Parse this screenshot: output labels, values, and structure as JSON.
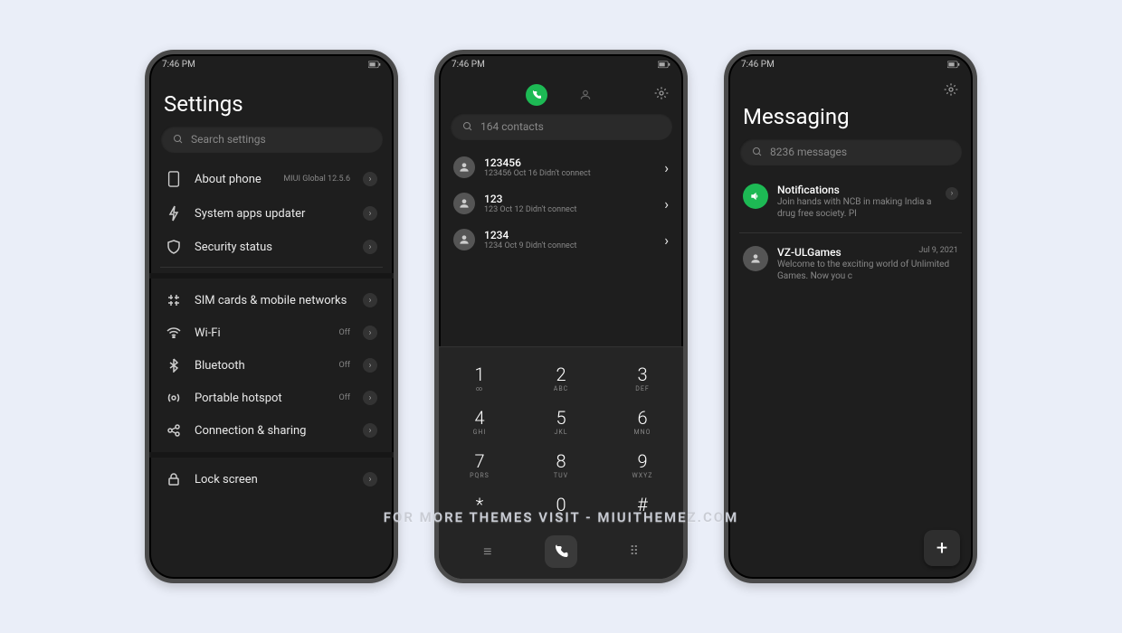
{
  "status": {
    "time": "7:46 PM"
  },
  "settings": {
    "title": "Settings",
    "search_placeholder": "Search settings",
    "items": [
      {
        "label": "About phone",
        "sub": "MIUI Global 12.5.6"
      },
      {
        "label": "System apps updater"
      },
      {
        "label": "Security status"
      }
    ],
    "net_items": [
      {
        "label": "SIM cards & mobile networks"
      },
      {
        "label": "Wi-Fi",
        "status": "Off"
      },
      {
        "label": "Bluetooth",
        "status": "Off"
      },
      {
        "label": "Portable hotspot",
        "status": "Off"
      },
      {
        "label": "Connection & sharing"
      }
    ],
    "lock": {
      "label": "Lock screen"
    }
  },
  "phone": {
    "search_placeholder": "164 contacts",
    "calls": [
      {
        "name": "123456",
        "detail": "123456  Oct 16 Didn't connect"
      },
      {
        "name": "123",
        "detail": "123  Oct 12 Didn't connect"
      },
      {
        "name": "1234",
        "detail": "1234  Oct 9 Didn't connect"
      }
    ],
    "dialpad": [
      {
        "num": "1",
        "let": "∞"
      },
      {
        "num": "2",
        "let": "ABC"
      },
      {
        "num": "3",
        "let": "DEF"
      },
      {
        "num": "4",
        "let": "GHI"
      },
      {
        "num": "5",
        "let": "JKL"
      },
      {
        "num": "6",
        "let": "MNO"
      },
      {
        "num": "7",
        "let": "PQRS"
      },
      {
        "num": "8",
        "let": "TUV"
      },
      {
        "num": "9",
        "let": "WXYZ"
      },
      {
        "num": "*",
        "let": ""
      },
      {
        "num": "0",
        "let": "+"
      },
      {
        "num": "#",
        "let": ""
      }
    ]
  },
  "messaging": {
    "title": "Messaging",
    "search_placeholder": "8236 messages",
    "threads": [
      {
        "name": "Notifications",
        "preview": "Join hands with NCB in making India a drug free society. Pl",
        "date": "",
        "green": true
      },
      {
        "name": "VZ-ULGames",
        "preview": "Welcome to the exciting world of Unlimited Games. Now you c",
        "date": "Jul 9, 2021"
      }
    ]
  },
  "watermark": "FOR MORE THEMES VISIT - MIUITHEMEZ.COM"
}
